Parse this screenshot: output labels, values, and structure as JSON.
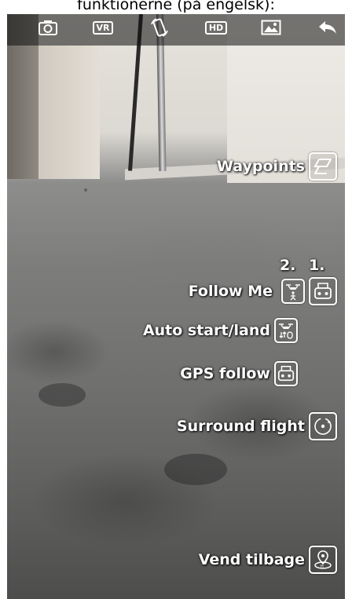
{
  "caption": "funktionerne (på engelsk):",
  "topbar": {
    "vr_label": "VR",
    "hd_label": "HD",
    "icons": [
      "camera-icon",
      "vr-icon",
      "rotate-phone-icon",
      "hd-icon",
      "gallery-icon",
      "back-arrow-icon"
    ]
  },
  "menu": {
    "waypoints": "Waypoints",
    "follow_me": "Follow Me",
    "follow_me_number_2": "2.",
    "follow_me_number_1": "1.",
    "auto_start_land": "Auto start/land",
    "gps_follow": "GPS follow",
    "surround_flight": "Surround flight",
    "return_home": "Vend tilbage"
  },
  "colors": {
    "overlay_text": "#ffffff",
    "topbar_bg": "rgba(15,15,15,0.55)"
  }
}
